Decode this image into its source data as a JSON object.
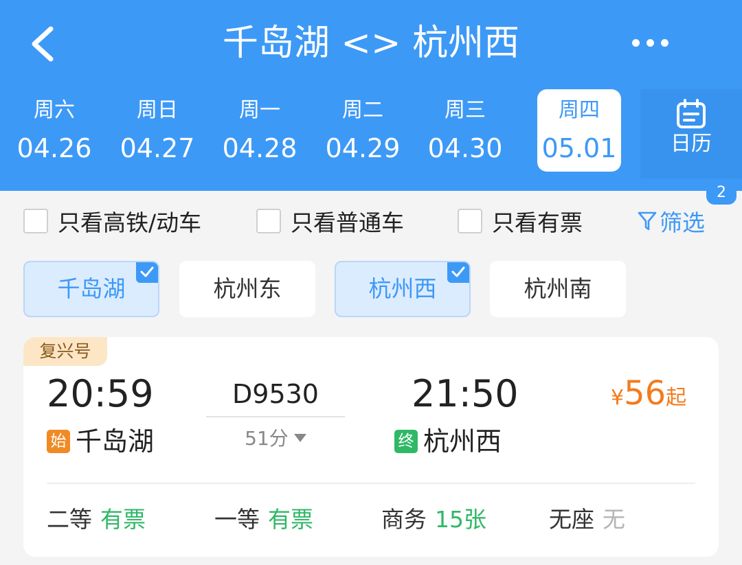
{
  "header": {
    "title": "千岛湖 <> 杭州西",
    "back_icon": "chevron-left-icon",
    "more_icon": "more-dots-icon",
    "colors": {
      "primary": "#3d99f6",
      "price": "#f37b1d",
      "available": "#2fb866"
    }
  },
  "dates": [
    {
      "weekday": "周六",
      "date": "04.26"
    },
    {
      "weekday": "周日",
      "date": "04.27"
    },
    {
      "weekday": "周一",
      "date": "04.28"
    },
    {
      "weekday": "周二",
      "date": "04.29"
    },
    {
      "weekday": "周三",
      "date": "04.30"
    },
    {
      "weekday": "周四",
      "date": "05.01",
      "selected": true
    }
  ],
  "calendar": {
    "label": "日历",
    "icon": "calendar-icon",
    "badge": "2"
  },
  "filters": {
    "high_speed": "只看高铁/动车",
    "normal": "只看普通车",
    "available": "只看有票",
    "screen": "筛选",
    "screen_icon": "funnel-icon"
  },
  "stations": [
    {
      "name": "千岛湖",
      "selected": true
    },
    {
      "name": "杭州东",
      "selected": false
    },
    {
      "name": "杭州西",
      "selected": true
    },
    {
      "name": "杭州南",
      "selected": false
    }
  ],
  "train": {
    "tag": "复兴号",
    "departure_time": "20:59",
    "departure_station": "千岛湖",
    "departure_mark": "始",
    "number": "D9530",
    "duration": "51分",
    "arrival_time": "21:50",
    "arrival_station": "杭州西",
    "arrival_mark": "终",
    "price_symbol": "¥",
    "price": "56",
    "price_suffix": "起",
    "seats": [
      {
        "type": "二等",
        "status": "有票"
      },
      {
        "type": "一等",
        "status": "有票"
      },
      {
        "type": "商务",
        "status": "15张"
      },
      {
        "type": "无座",
        "status": "无"
      }
    ]
  }
}
